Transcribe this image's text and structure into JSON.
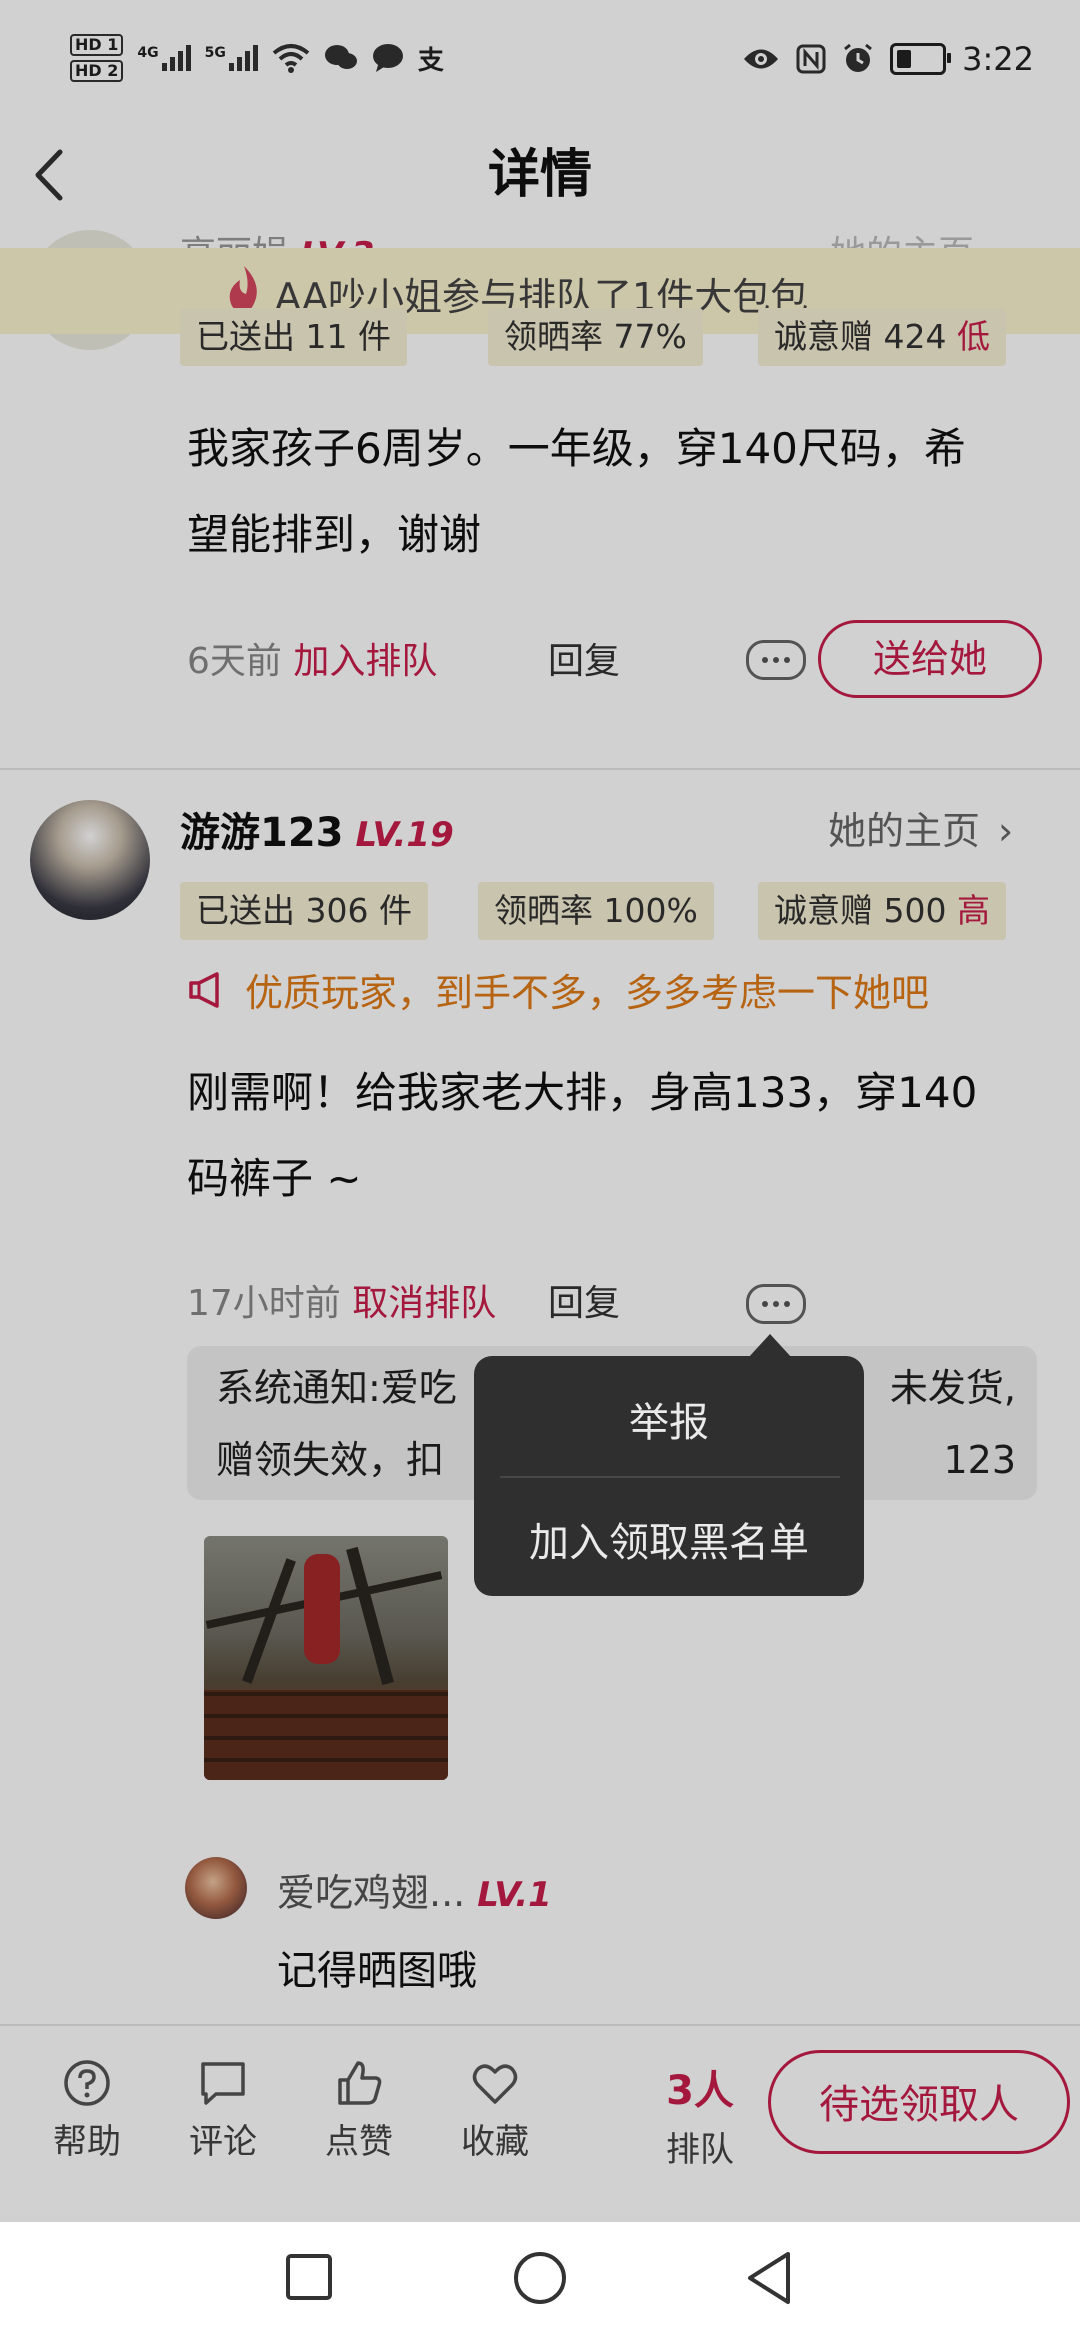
{
  "status_bar": {
    "hd1": "HD 1",
    "hd2": "HD 2",
    "net1": "4G",
    "net2": "5G",
    "icons_left": [
      "sim-signal-icon",
      "sim-signal-icon",
      "wifi-icon",
      "wechat-icon",
      "message-icon",
      "alipay-icon"
    ],
    "icons_right": [
      "eye-icon",
      "nfc-icon",
      "alarm-icon",
      "battery-icon"
    ],
    "time": "3:22"
  },
  "header": {
    "title": "详情"
  },
  "banner": {
    "text": "AA吵小姐参与排队了1件大包包"
  },
  "comment1": {
    "name": "高丽娟",
    "level": "LV.3",
    "home_link": "她的主页",
    "stats": {
      "sent": "已送出 11 件",
      "rate": "领晒率 77%",
      "gift_label": "诚意赠 424",
      "gift_level": "低"
    },
    "text_line1": "我家孩子6周岁。一年级，穿140尺码，希",
    "text_line2": "望能排到，谢谢",
    "time": "6天前",
    "action": "加入排队",
    "reply": "回复",
    "send_button": "送给她"
  },
  "comment2": {
    "name": "游游123",
    "level": "LV.19",
    "home_link": "她的主页",
    "stats": {
      "sent": "已送出 306 件",
      "rate": "领晒率 100%",
      "gift_label": "诚意赠 500",
      "gift_level": "高"
    },
    "notice": "优质玩家，到手不多，多多考虑一下她吧",
    "text_line1": "刚需啊！给我家老大排，身高133，穿140",
    "text_line2": "码裤子 ~",
    "time": "17小时前",
    "action": "取消排队",
    "reply": "回复",
    "system_line1_left": "系统通知:爱吃",
    "system_line1_right": "未发货,",
    "system_line2_left": "赠领失效，扣",
    "system_line2_right": "123"
  },
  "reply_item": {
    "name": "爱吃鸡翅...",
    "level": "LV.1",
    "text": "记得晒图哦"
  },
  "popup": {
    "item1": "举报",
    "item2": "加入领取黑名单"
  },
  "bottom_bar": {
    "help": "帮助",
    "comment": "评论",
    "like": "点赞",
    "favorite": "收藏",
    "queue_count": "3人",
    "queue_label": "排队",
    "pick_button": "待选领取人"
  },
  "colors": {
    "accent": "#c81e4b",
    "notice": "#e07a16",
    "chip_bg": "#f6efd3"
  }
}
